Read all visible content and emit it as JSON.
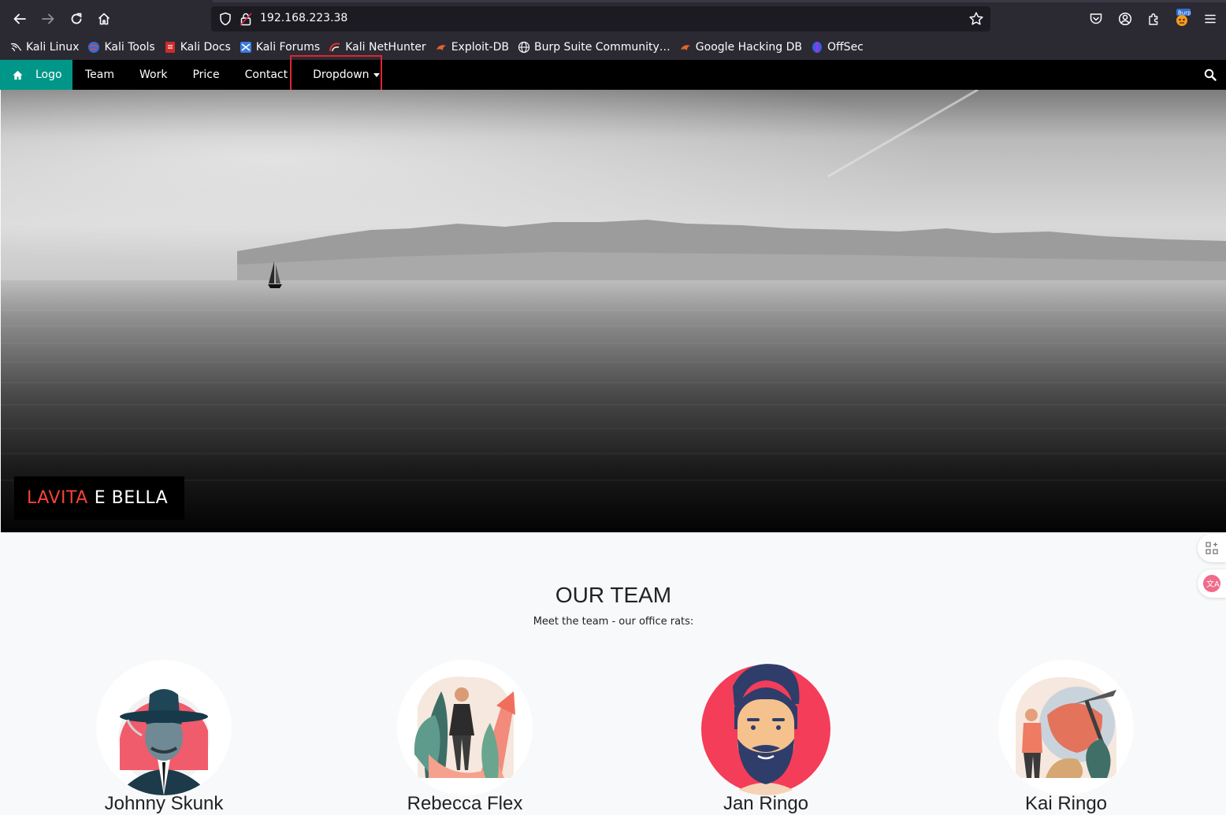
{
  "browser": {
    "url": "192.168.223.38",
    "bookmarks": [
      {
        "label": "Kali Linux",
        "icon": "kali-dragon-icon"
      },
      {
        "label": "Kali Tools",
        "icon": "kali-tools-icon"
      },
      {
        "label": "Kali Docs",
        "icon": "kali-docs-icon"
      },
      {
        "label": "Kali Forums",
        "icon": "kali-forums-icon"
      },
      {
        "label": "Kali NetHunter",
        "icon": "nethunter-icon"
      },
      {
        "label": "Exploit-DB",
        "icon": "exploit-db-icon"
      },
      {
        "label": "Burp Suite Community…",
        "icon": "globe-icon"
      },
      {
        "label": "Google Hacking DB",
        "icon": "ghdb-icon"
      },
      {
        "label": "OffSec",
        "icon": "offsec-icon"
      }
    ]
  },
  "nav": {
    "logo": "Logo",
    "items": [
      "Team",
      "Work",
      "Price",
      "Contact"
    ],
    "dropdown": "Dropdown",
    "accent": "#009688"
  },
  "hero": {
    "caption_red": "LAVITA",
    "caption_white": "E BELLA"
  },
  "team": {
    "title": "OUR TEAM",
    "subtitle": "Meet the team - our office rats:",
    "members": [
      {
        "name": "Johnny Skunk"
      },
      {
        "name": "Rebecca Flex"
      },
      {
        "name": "Jan Ringo"
      },
      {
        "name": "Kai Ringo"
      }
    ]
  }
}
